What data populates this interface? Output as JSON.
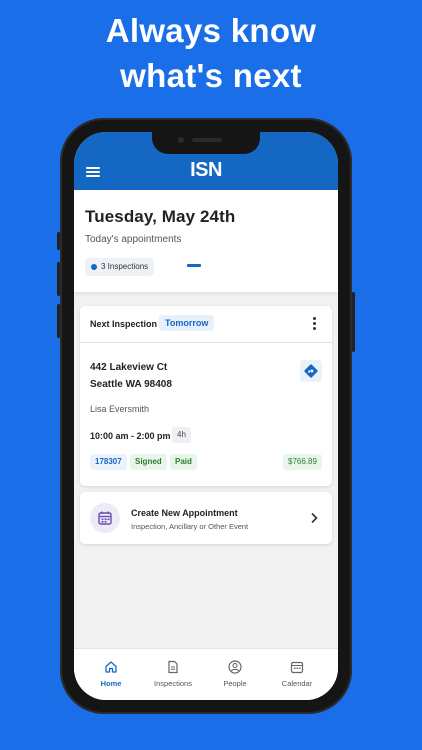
{
  "headline": {
    "line1": "Always know",
    "line2": "what's next"
  },
  "app": {
    "logo": "ISN"
  },
  "today": {
    "date": "Tuesday, May 24th",
    "subtitle": "Today's appointments",
    "inspections_chip": "3 Inspections"
  },
  "next_inspection": {
    "label": "Next Inspection",
    "when": "Tomorrow",
    "address_line1": "442 Lakeview Ct",
    "address_line2": "Seattle WA 98408",
    "client": "Lisa Eversmith",
    "time": "10:00 am - 2:00 pm",
    "duration": "4h",
    "id": "178307",
    "signed": "Signed",
    "paid": "Paid",
    "amount": "$766.89"
  },
  "create": {
    "title": "Create New Appointment",
    "subtitle": "Inspection, Ancillary or Other Event"
  },
  "tabs": [
    {
      "label": "Home",
      "icon": "home-icon",
      "active": true
    },
    {
      "label": "Inspections",
      "icon": "document-icon",
      "active": false
    },
    {
      "label": "People",
      "icon": "person-icon",
      "active": false
    },
    {
      "label": "Calendar",
      "icon": "calendar-icon",
      "active": false
    }
  ],
  "colors": {
    "background": "#1a6fe8",
    "app_bar": "#1468c4",
    "accent": "#1468c4",
    "success": "#2e7d32",
    "create_icon": "#6a4fb3"
  }
}
